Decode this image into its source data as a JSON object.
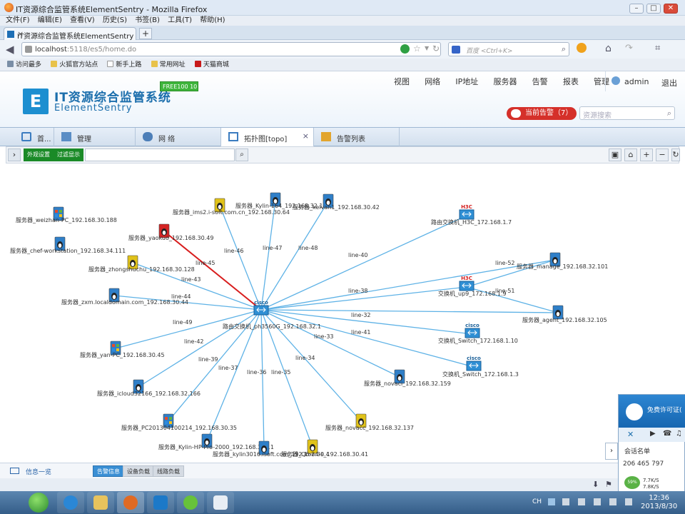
{
  "browser": {
    "window_title": "IT资源综合监管系统ElementSentry - Mozilla Firefox",
    "menu": [
      "文件(F)",
      "编辑(E)",
      "查看(V)",
      "历史(S)",
      "书签(B)",
      "工具(T)",
      "帮助(H)"
    ],
    "tab_title": "IT资源综合监管系统ElementSentry",
    "url_host": "localhost",
    "url_rest": ":5118/es5/home.do",
    "search_placeholder": "百度 <Ctrl+K>",
    "bookmarks": [
      "访问最多",
      "火狐官方站点",
      "新手上路",
      "常用网址",
      "天猫商城"
    ]
  },
  "app": {
    "title": "IT资源综合监管系统",
    "subtitle": "ElementSentry",
    "badge": "FREE100  10",
    "nav": [
      "视图",
      "网络",
      "IP地址",
      "服务器",
      "告警",
      "报表",
      "管理"
    ],
    "user": "admin",
    "logout": "退出",
    "alarm_button": "当前告警（7）",
    "resource_search_placeholder": "资源搜索",
    "tabs": [
      "首...",
      "管理",
      "网 络",
      "拓扑图[topo]",
      "告警列表"
    ],
    "toolbar": {
      "appearance": "外观设置",
      "filter": "过滤显示"
    },
    "bottom": {
      "info": "信息一览",
      "tabs": [
        "告警信息",
        "设备负载",
        "线路负载"
      ]
    }
  },
  "topology": {
    "center": {
      "label": "路由交换机_ph3560G_192.168.32.1",
      "type": "cisco-router"
    },
    "nodes": [
      {
        "id": "weizhan",
        "label": "服务器_weizhan-PC_192.168.30.188",
        "icon": "windows-server",
        "link": ""
      },
      {
        "id": "chef",
        "label": "服务器_chef-workstation_192.168.34.111",
        "icon": "linux-server",
        "link": ""
      },
      {
        "id": "ims2",
        "label": "服务器_ims2.i-soft.com.cn_192.168.30.64",
        "icon": "linux-server-yellow",
        "link": "line-46"
      },
      {
        "id": "kylin164",
        "label": "服务器_Kylin-164_192.168.32.164",
        "icon": "linux-server",
        "link": "line-47"
      },
      {
        "id": "kelvan",
        "label": "服务器_kelvan1_192.168.30.42",
        "icon": "linux-server",
        "link": "line-48"
      },
      {
        "id": "h3c701",
        "label": "路由交换机_H3C_172.168.1.7",
        "icon": "h3c-router",
        "link": "line-40"
      },
      {
        "id": "yaokuo",
        "label": "服务器_yaokuo_192.168.30.49",
        "icon": "linux-server-red",
        "link": "line-45"
      },
      {
        "id": "zhongshu",
        "label": "服务器_zhongshuchu_192.168.30.128",
        "icon": "linux-server-yellow",
        "link": "line-43"
      },
      {
        "id": "manage",
        "label": "服务器_manage_192.168.32.101",
        "icon": "linux-server",
        "link": "line-52"
      },
      {
        "id": "up9",
        "label": "交换机_up9_172.168.1.9",
        "icon": "h3c-switch",
        "link": "line-38"
      },
      {
        "id": "zxm",
        "label": "服务器_zxm.localdomain.com_192.168.30.44",
        "icon": "linux-server",
        "link": "line-44"
      },
      {
        "id": "agent",
        "label": "服务器_agent_192.168.32.105",
        "icon": "linux-server",
        "link": "line-51"
      },
      {
        "id": "sw110",
        "label": "交换机_Switch_172.168.1.10",
        "icon": "cisco-switch",
        "link": "line-32"
      },
      {
        "id": "sw13",
        "label": "交换机_Switch_172.168.1.3",
        "icon": "cisco-switch",
        "link": "line-41"
      },
      {
        "id": "yan",
        "label": "服务器_yan-PC_192.168.30.45",
        "icon": "windows-server",
        "link": "line-49"
      },
      {
        "id": "novaci",
        "label": "服务器_novaci_192.168.32.159",
        "icon": "linux-server",
        "link": "line-33"
      },
      {
        "id": "icloud",
        "label": "服务器_icloud32166_192.168.32.166",
        "icon": "linux-server",
        "link": "line-42"
      },
      {
        "id": "pc2013",
        "label": "服务器_PC201304100214_192.168.30.35",
        "icon": "windows-server",
        "link": "line-39"
      },
      {
        "id": "novacc",
        "label": "服务器_novacc_192.168.32.137",
        "icon": "linux-server-yellow",
        "link": "line-34"
      },
      {
        "id": "kylinhp",
        "label": "服务器_Kylin-HP-Pro-2000_192.168.30.11",
        "icon": "linux-server",
        "link": "line-37"
      },
      {
        "id": "kylin3016",
        "label": "服务器_kylin3016.isoft.com_192.168.30.4",
        "icon": "linux-server",
        "link": "line-36"
      },
      {
        "id": "q6",
        "label": "服务器_Q6-24-s_192.168.30.41",
        "icon": "linux-server-yellow",
        "link": "line-35"
      }
    ],
    "extra_links": [
      {
        "from": "up9",
        "to": "manage",
        "label": "line-52"
      },
      {
        "from": "up9",
        "to": "agent",
        "label": "line-51"
      }
    ],
    "alert_link": "line-45",
    "colors": {
      "link": "#5eb2e6",
      "alert": "#d81e1e"
    }
  },
  "teamviewer": {
    "title": "免费许可证(",
    "sessions": "会话名单",
    "id": "206 465 797",
    "net": "59%",
    "up": "7.7K/S",
    "down": "7.8K/S"
  },
  "taskbar": {
    "time": "12:36",
    "date": "2013/8/30",
    "ime": "CH"
  }
}
